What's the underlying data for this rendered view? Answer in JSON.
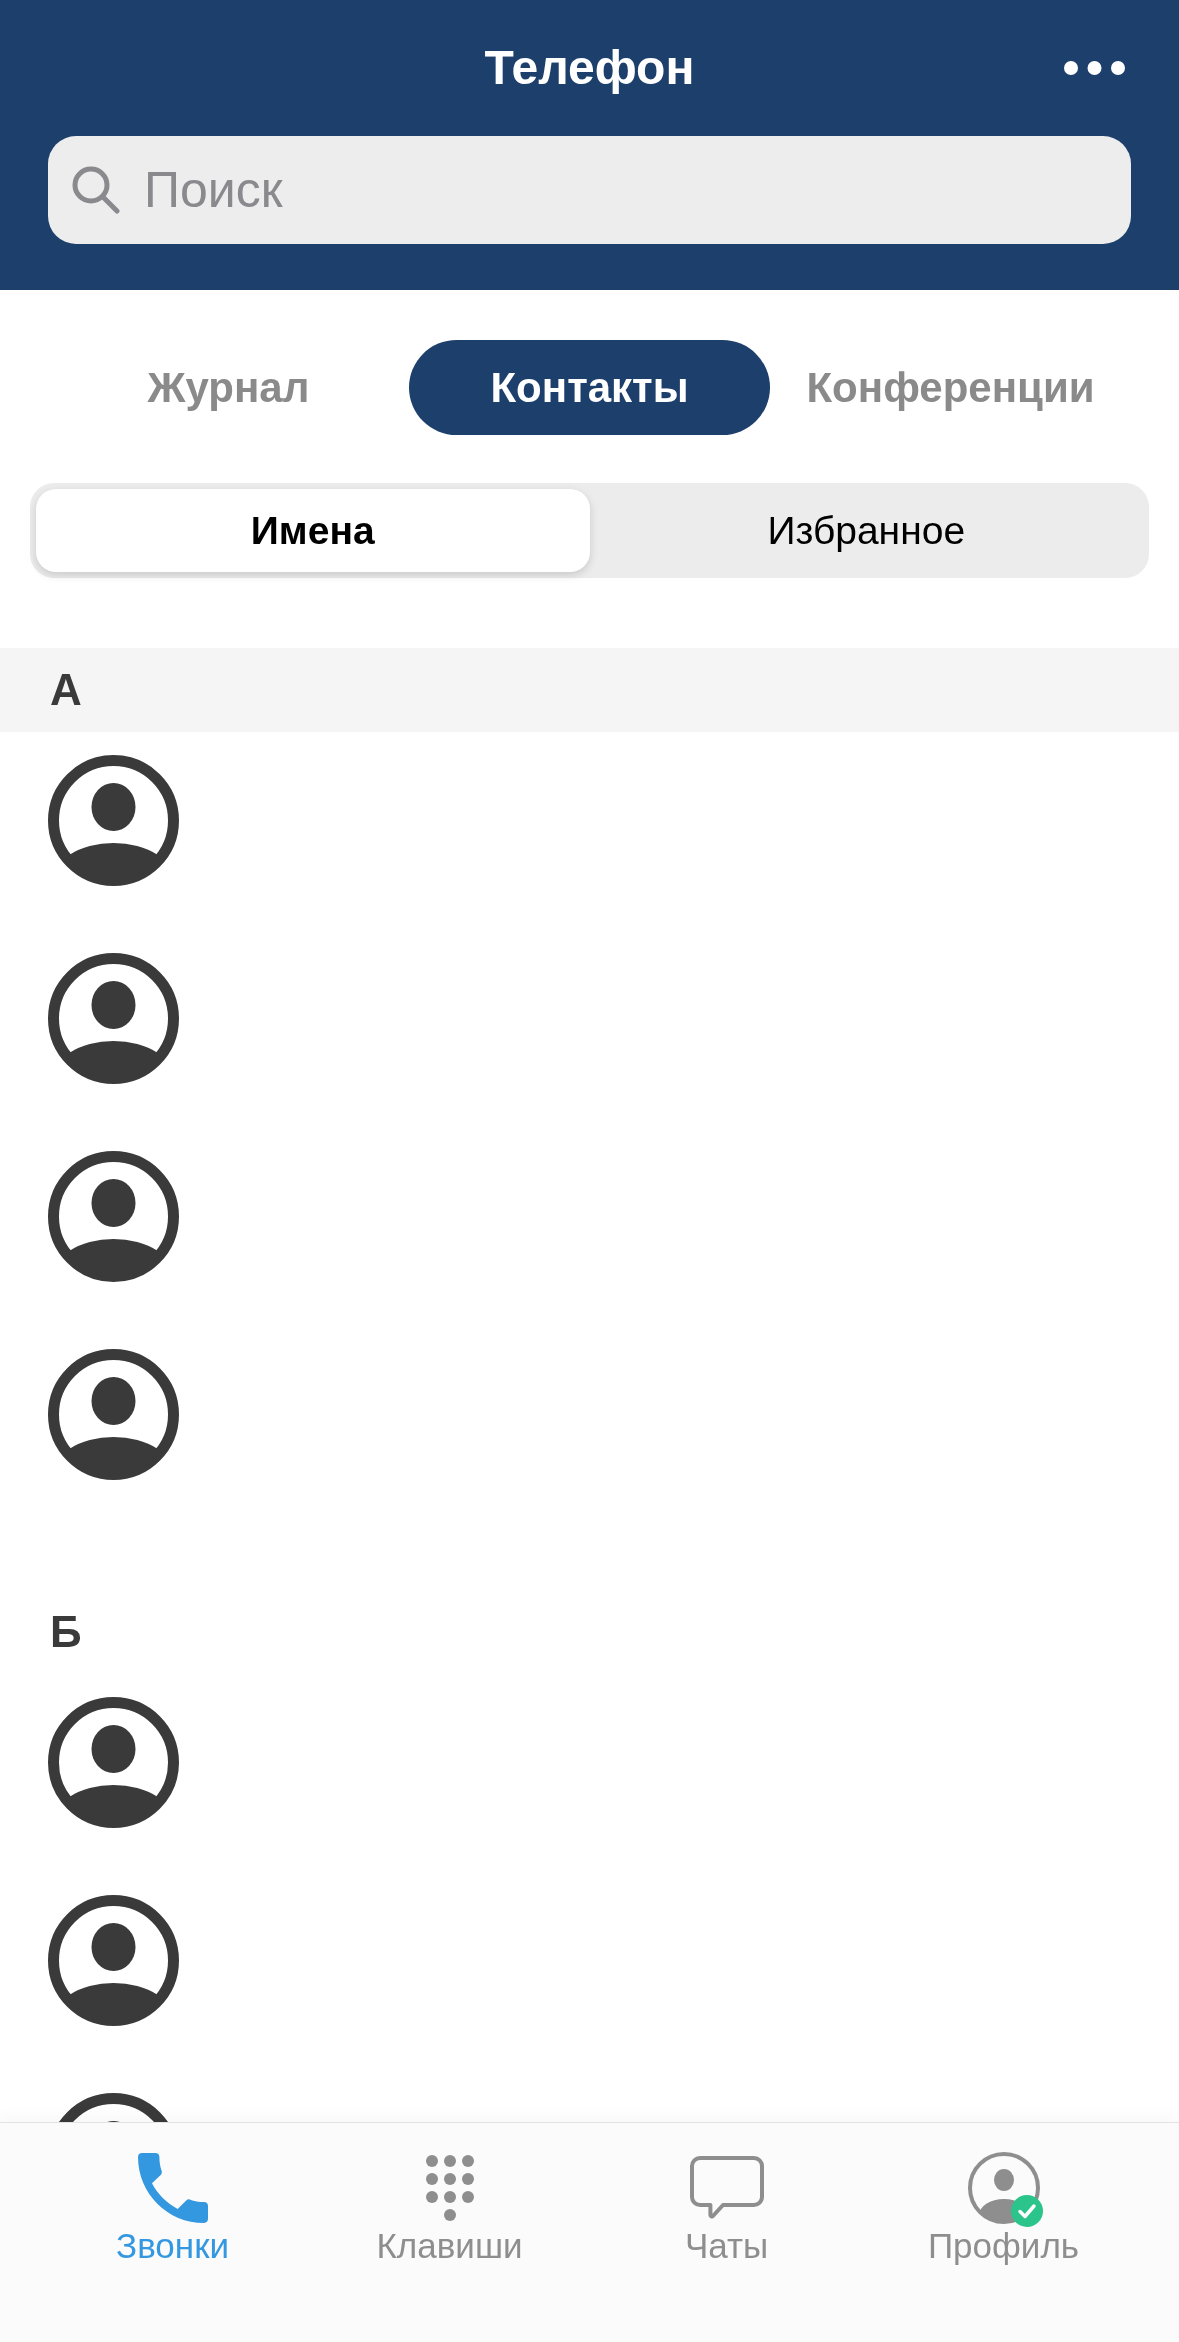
{
  "header": {
    "title": "Телефон",
    "search": {
      "placeholder": "Поиск"
    }
  },
  "tabs": [
    {
      "label": "Журнал",
      "selected": false
    },
    {
      "label": "Контакты",
      "selected": true
    },
    {
      "label": "Конференции",
      "selected": false
    }
  ],
  "segments": [
    {
      "label": "Имена",
      "selected": true
    },
    {
      "label": "Избранное",
      "selected": false
    }
  ],
  "sections": [
    {
      "letter": "А",
      "pinned": true,
      "contacts": [
        {
          "default_avatar": true
        },
        {
          "default_avatar": true
        },
        {
          "default_avatar": true
        },
        {
          "default_avatar": true
        }
      ]
    },
    {
      "letter": "Б",
      "pinned": false,
      "contacts": [
        {
          "default_avatar": true
        },
        {
          "default_avatar": true
        },
        {
          "default_avatar": true
        }
      ]
    }
  ],
  "tab_bar": [
    {
      "kind": "calls",
      "label": "Звонки",
      "selected": true
    },
    {
      "kind": "keypad",
      "label": "Клавиши",
      "selected": false
    },
    {
      "kind": "chats",
      "label": "Чаты",
      "selected": false
    },
    {
      "kind": "profile",
      "label": "Профиль",
      "selected": false,
      "online": true
    }
  ]
}
